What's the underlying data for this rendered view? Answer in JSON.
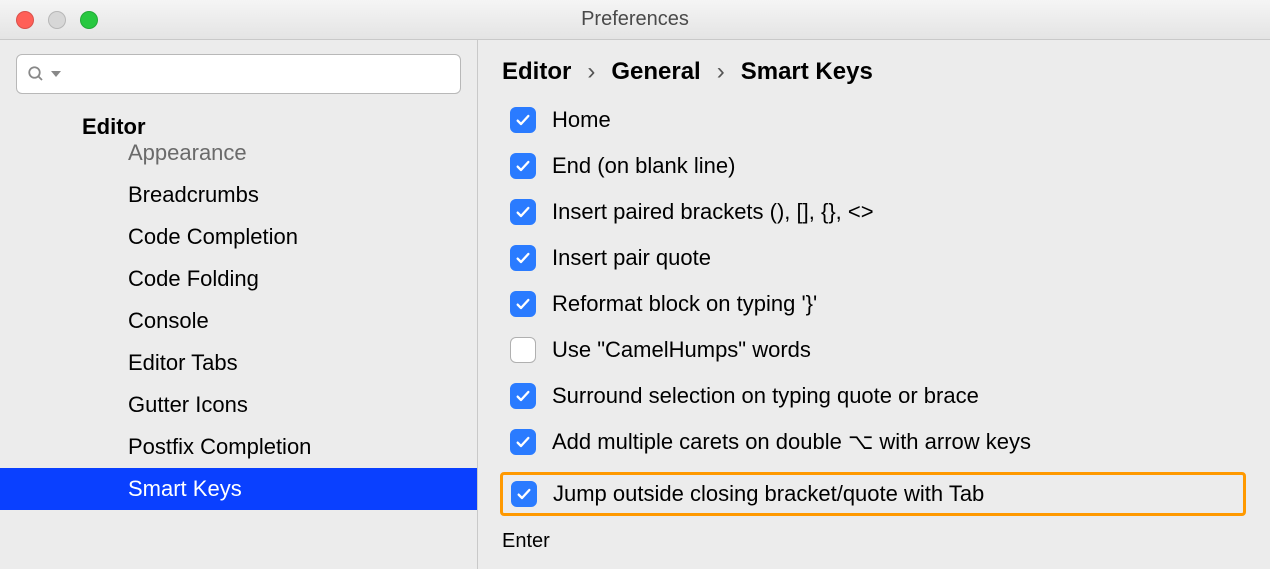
{
  "window": {
    "title": "Preferences"
  },
  "search": {
    "placeholder": ""
  },
  "sidebar": {
    "heading": "Editor",
    "items": [
      {
        "label": "Appearance",
        "cut": true,
        "selected": false
      },
      {
        "label": "Breadcrumbs",
        "cut": false,
        "selected": false
      },
      {
        "label": "Code Completion",
        "cut": false,
        "selected": false
      },
      {
        "label": "Code Folding",
        "cut": false,
        "selected": false
      },
      {
        "label": "Console",
        "cut": false,
        "selected": false
      },
      {
        "label": "Editor Tabs",
        "cut": false,
        "selected": false
      },
      {
        "label": "Gutter Icons",
        "cut": false,
        "selected": false
      },
      {
        "label": "Postfix Completion",
        "cut": false,
        "selected": false
      },
      {
        "label": "Smart Keys",
        "cut": false,
        "selected": true
      }
    ]
  },
  "breadcrumb": [
    "Editor",
    "General",
    "Smart Keys"
  ],
  "options": [
    {
      "label": "Home",
      "checked": true,
      "highlight": false
    },
    {
      "label": "End (on blank line)",
      "checked": true,
      "highlight": false
    },
    {
      "label": "Insert paired brackets (), [], {}, <>",
      "checked": true,
      "highlight": false
    },
    {
      "label": "Insert pair quote",
      "checked": true,
      "highlight": false
    },
    {
      "label": "Reformat block on typing '}'",
      "checked": true,
      "highlight": false
    },
    {
      "label": "Use \"CamelHumps\" words",
      "checked": false,
      "highlight": false
    },
    {
      "label": "Surround selection on typing quote or brace",
      "checked": true,
      "highlight": false
    },
    {
      "label": "Add multiple carets on double ⌥ with arrow keys",
      "checked": true,
      "highlight": false
    },
    {
      "label": "Jump outside closing bracket/quote with Tab",
      "checked": true,
      "highlight": true
    }
  ],
  "section_after": "Enter",
  "colors": {
    "selection": "#0a40ff",
    "checkbox": "#2a7bff",
    "highlight": "#ff9900"
  }
}
